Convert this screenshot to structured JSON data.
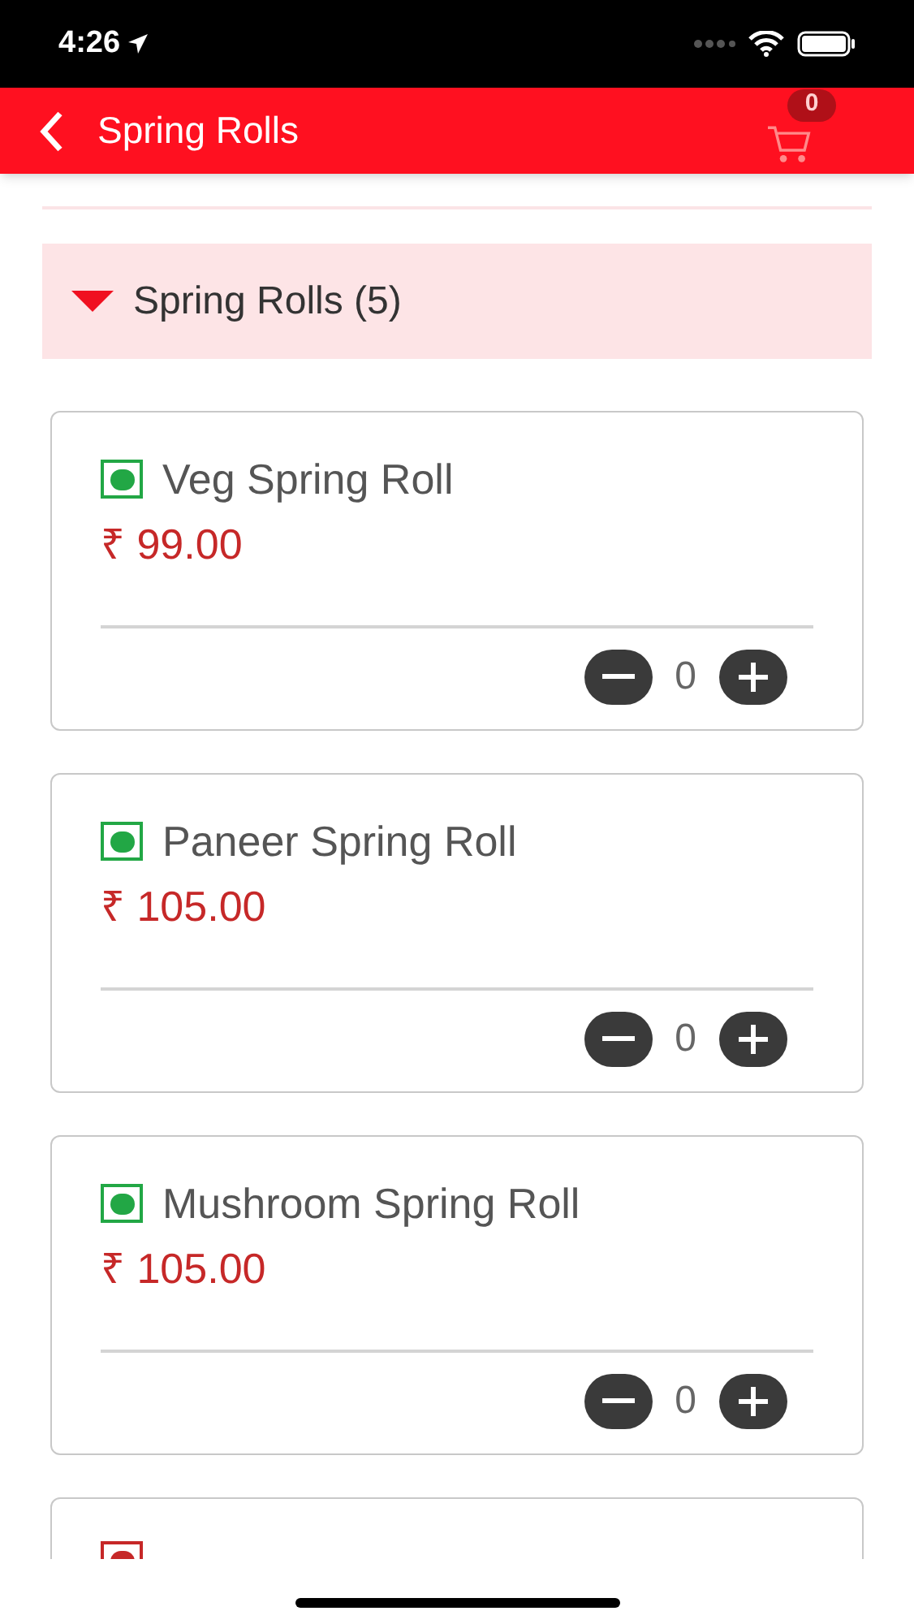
{
  "status_bar": {
    "time": "4:26"
  },
  "header": {
    "title": "Spring Rolls",
    "cart_count": "0"
  },
  "section": {
    "title": "Spring Rolls (5)",
    "expanded": true
  },
  "items": [
    {
      "name": "Veg Spring Roll",
      "price": "₹ 99.00",
      "quantity": "0",
      "color": "#22a745"
    },
    {
      "name": "Paneer Spring Roll",
      "price": "₹ 105.00",
      "quantity": "0",
      "color": "#22a745"
    },
    {
      "name": "Mushroom Spring Roll",
      "price": "₹ 105.00",
      "quantity": "0",
      "color": "#22a745"
    },
    {
      "color": "#c62828"
    }
  ]
}
